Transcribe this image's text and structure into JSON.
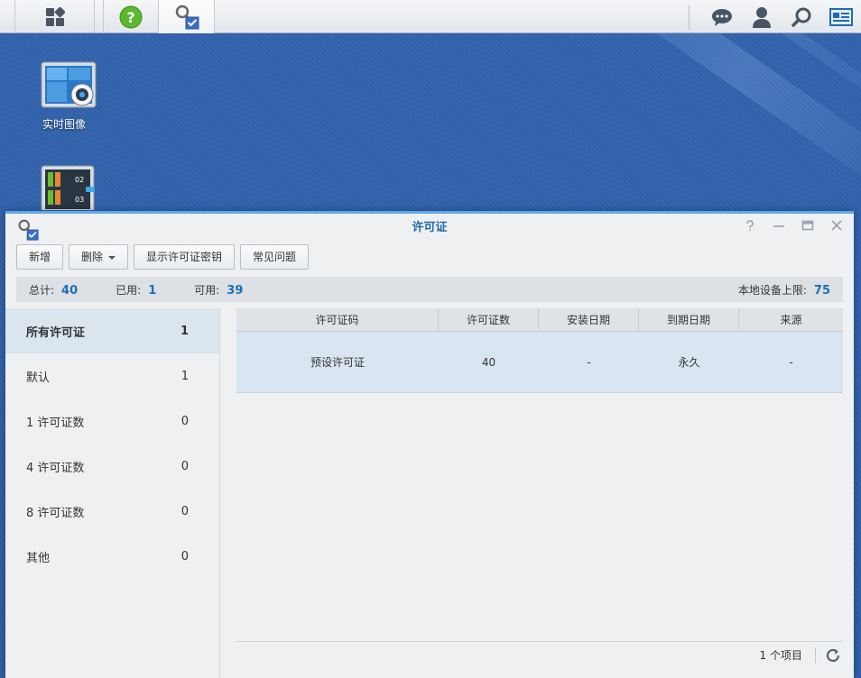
{
  "taskbar": {
    "main_menu_icon": "grid-icon",
    "help_icon": "help-icon",
    "license_icon": "license-key-icon",
    "right_icons": [
      "chat-icon",
      "user-icon",
      "search-icon",
      "widgets-icon"
    ]
  },
  "desktop": {
    "icons": [
      {
        "label": "实时图像",
        "icon": "live-view-icon"
      },
      {
        "label": "",
        "icon": "timeline-icon"
      }
    ]
  },
  "window": {
    "title": "许可证",
    "toolbar": {
      "add": "新增",
      "delete": "删除",
      "show_key": "显示许可证密钥",
      "faq": "常见问题"
    },
    "summary": {
      "total_label": "总计:",
      "total": "40",
      "used_label": "已用:",
      "used": "1",
      "available_label": "可用:",
      "available": "39",
      "limit_label": "本地设备上限:",
      "limit": "75"
    },
    "sidebar": [
      {
        "label": "所有许可证",
        "count": "1"
      },
      {
        "label": "默认",
        "count": "1"
      },
      {
        "label": "1 许可证数",
        "count": "0"
      },
      {
        "label": "4 许可证数",
        "count": "0"
      },
      {
        "label": "8 许可证数",
        "count": "0"
      },
      {
        "label": "其他",
        "count": "0"
      }
    ],
    "table": {
      "columns": [
        "许可证码",
        "许可证数",
        "安装日期",
        "到期日期",
        "来源"
      ],
      "rows": [
        [
          "预设许可证",
          "40",
          "-",
          "永久",
          "-"
        ]
      ]
    },
    "footer": {
      "count_text": "1 个项目"
    }
  },
  "colors": {
    "accent": "#1a71b8",
    "desktop": "#2f5ea3",
    "selected_row": "#d9e5f0"
  }
}
